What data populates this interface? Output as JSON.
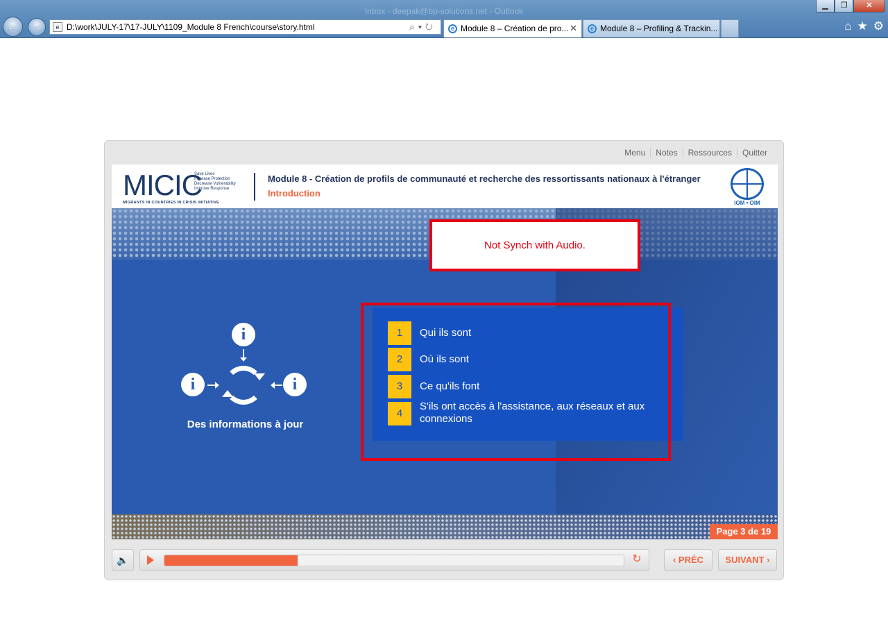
{
  "browser": {
    "window_title": "Inbox - deepak@bp-solutions.net - Outlook",
    "url": "D:\\work\\JULY-17\\17-JULY\\1109_Module 8 French\\course\\story.html",
    "tabs": [
      {
        "label": "Module 8 – Création de pro...",
        "active": true
      },
      {
        "label": "Module 8 – Profiling & Trackin...",
        "active": false
      }
    ],
    "win_controls": {
      "minimize": "▁",
      "restore": "❐",
      "close": "✕"
    },
    "nav": {
      "back": "←",
      "forward": "→"
    },
    "addr_tools": "⌕▾↻",
    "page_icon": "e",
    "icons": {
      "home": "⌂",
      "favorites": "★",
      "settings": "⚙"
    }
  },
  "player": {
    "top_menu": [
      "Menu",
      "Notes",
      "Ressources",
      "Quitter"
    ],
    "logo": {
      "name": "MICIC",
      "tagline": [
        "Save Lives",
        "Increase Protection",
        "Decrease Vulnerability",
        "Improve Response"
      ],
      "subtitle": "MIGRANTS IN COUNTRIES IN CRISIS INITIATIVE"
    },
    "module_title": "Module 8 - Création de profils de communauté et recherche des ressortissants nationaux à l'étranger",
    "module_subtitle": "Introduction",
    "iom_label": "IOM • OIM",
    "annotation_note": "Not Synch with Audio.",
    "info_glyph": "i",
    "info_caption": "Des informations à jour",
    "list": [
      {
        "num": "1",
        "text": "Qui ils sont"
      },
      {
        "num": "2",
        "text": "Où ils sont"
      },
      {
        "num": "3",
        "text": "Ce qu'ils font"
      },
      {
        "num": "4",
        "text": "S'ils ont accès à l'assistance, aux réseaux et aux connexions"
      }
    ],
    "page_indicator": "Page 3 de 19",
    "controls": {
      "volume_icon": "speaker-icon",
      "volume_glyph": "🔈",
      "replay_glyph": "↻",
      "progress_fraction": 0.29,
      "prev_label": "‹ PRÉC",
      "next_label": "SUIVANT ›"
    }
  },
  "colors": {
    "accent": "#f0653f",
    "number_box": "#ffc20e",
    "panel_blue": "#1651c2",
    "annotation_red": "#e60012"
  }
}
